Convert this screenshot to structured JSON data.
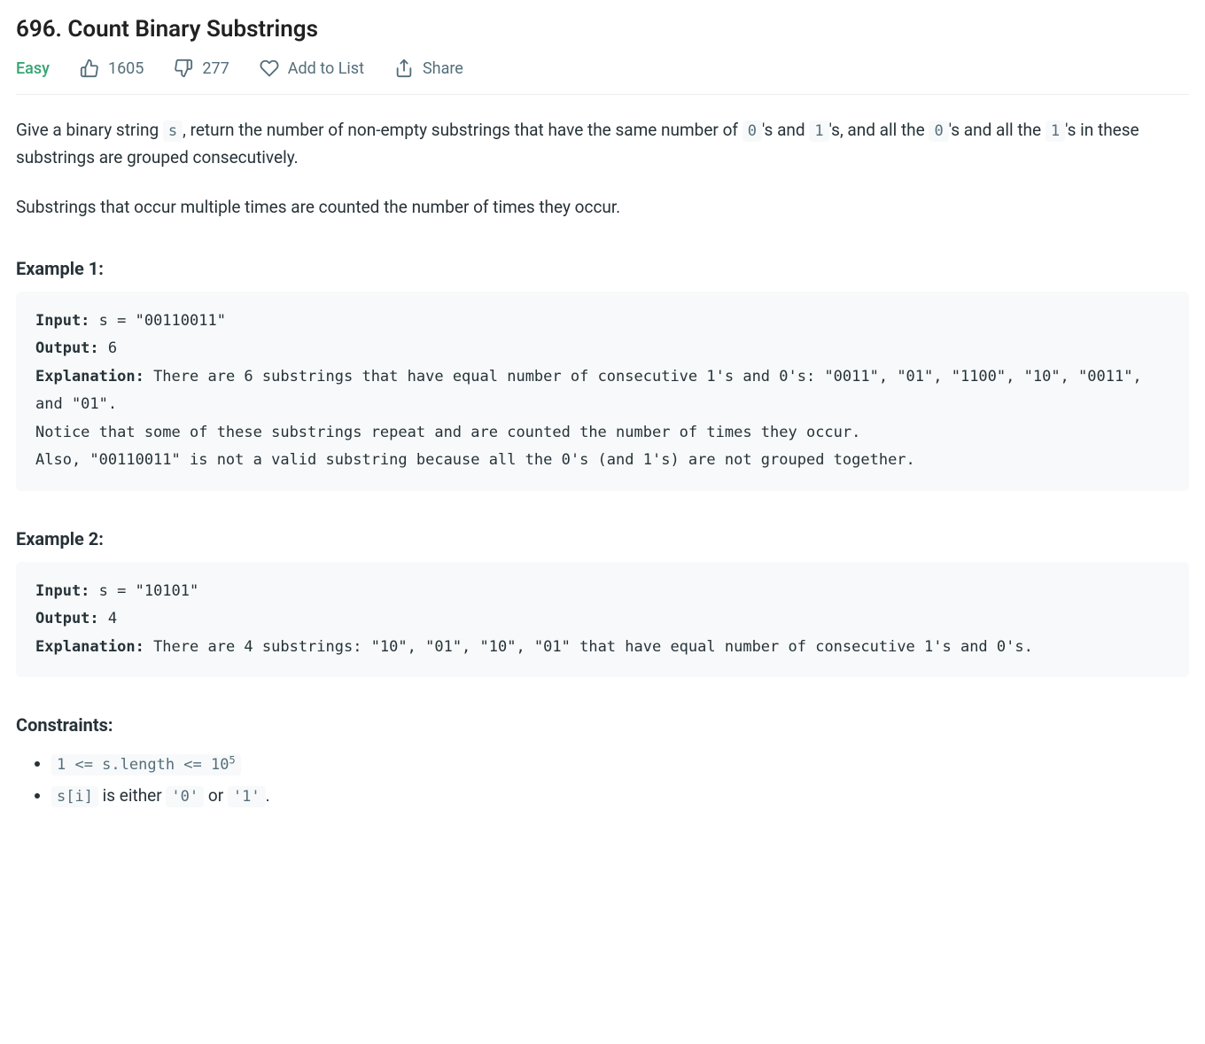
{
  "title": "696. Count Binary Substrings",
  "meta": {
    "difficulty": "Easy",
    "likes": "1605",
    "dislikes": "277",
    "add_to_list": "Add to List",
    "share": "Share"
  },
  "description": {
    "p1_a": "Give a binary string ",
    "p1_code1": "s",
    "p1_b": ", return the number of non-empty substrings that have the same number of ",
    "p1_code2": "0",
    "p1_c": "'s and ",
    "p1_code3": "1",
    "p1_d": "'s, and all the ",
    "p1_code4": "0",
    "p1_e": "'s and all the ",
    "p1_code5": "1",
    "p1_f": "'s in these substrings are grouped consecutively.",
    "p2": "Substrings that occur multiple times are counted the number of times they occur."
  },
  "example1": {
    "heading": "Example 1:",
    "input_label": "Input:",
    "input_value": " s = \"00110011\"",
    "output_label": "Output:",
    "output_value": " 6",
    "explanation_label": "Explanation:",
    "explanation_value": " There are 6 substrings that have equal number of consecutive 1's and 0's: \"0011\", \"01\", \"1100\", \"10\", \"0011\", and \"01\".\nNotice that some of these substrings repeat and are counted the number of times they occur.\nAlso, \"00110011\" is not a valid substring because all the 0's (and 1's) are not grouped together."
  },
  "example2": {
    "heading": "Example 2:",
    "input_label": "Input:",
    "input_value": " s = \"10101\"",
    "output_label": "Output:",
    "output_value": " 4",
    "explanation_label": "Explanation:",
    "explanation_value": " There are 4 substrings: \"10\", \"01\", \"10\", \"01\" that have equal number of consecutive 1's and 0's."
  },
  "constraints": {
    "heading": "Constraints:",
    "c1_code": "1 <= s.length <= 10",
    "c1_sup": "5",
    "c2_code1": "s[i]",
    "c2_mid": " is either ",
    "c2_code2": "'0'",
    "c2_or": " or ",
    "c2_code3": "'1'",
    "c2_end": "."
  }
}
